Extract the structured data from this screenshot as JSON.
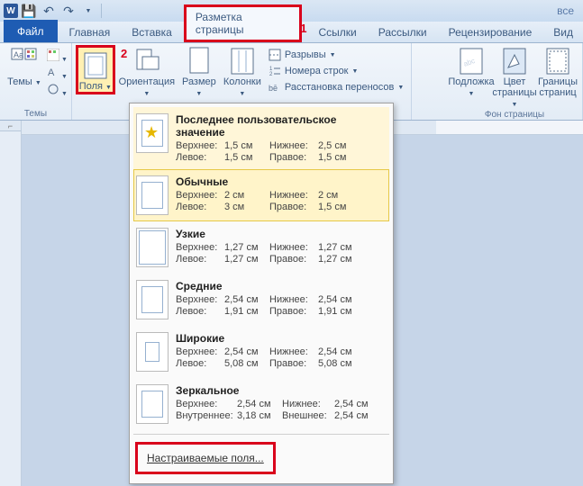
{
  "qat": {
    "save": "💾",
    "undo": "↶",
    "redo": "↷"
  },
  "titlebar_right": "все",
  "tabs": {
    "file": "Файл",
    "home": "Главная",
    "insert": "Вставка",
    "layout": "Разметка страницы",
    "references": "Ссылки",
    "mailings": "Рассылки",
    "review": "Рецензирование",
    "view": "Вид"
  },
  "annotation1": "1",
  "annotation2": "2",
  "ribbon": {
    "themes_group": "Темы",
    "themes": "Темы",
    "margins": "Поля",
    "orientation": "Ориентация",
    "size": "Размер",
    "columns": "Колонки",
    "breaks": "Разрывы",
    "line_numbers": "Номера строк",
    "hyphenation": "Расстановка переносов",
    "watermark": "Подложка",
    "page_color": "Цвет страницы",
    "borders": "Границы страниц",
    "bg_group": "Фон страницы"
  },
  "dropdown": {
    "last": {
      "title": "Последнее пользовательское значение",
      "top_l": "Верхнее:",
      "top_v": "1,5 см",
      "bot_l": "Нижнее:",
      "bot_v": "2,5 см",
      "left_l": "Левое:",
      "left_v": "1,5 см",
      "right_l": "Правое:",
      "right_v": "1,5 см"
    },
    "normal": {
      "title": "Обычные",
      "top_l": "Верхнее:",
      "top_v": "2 см",
      "bot_l": "Нижнее:",
      "bot_v": "2 см",
      "left_l": "Левое:",
      "left_v": "3 см",
      "right_l": "Правое:",
      "right_v": "1,5 см"
    },
    "narrow": {
      "title": "Узкие",
      "top_l": "Верхнее:",
      "top_v": "1,27 см",
      "bot_l": "Нижнее:",
      "bot_v": "1,27 см",
      "left_l": "Левое:",
      "left_v": "1,27 см",
      "right_l": "Правое:",
      "right_v": "1,27 см"
    },
    "moderate": {
      "title": "Средние",
      "top_l": "Верхнее:",
      "top_v": "2,54 см",
      "bot_l": "Нижнее:",
      "bot_v": "2,54 см",
      "left_l": "Левое:",
      "left_v": "1,91 см",
      "right_l": "Правое:",
      "right_v": "1,91 см"
    },
    "wide": {
      "title": "Широкие",
      "top_l": "Верхнее:",
      "top_v": "2,54 см",
      "bot_l": "Нижнее:",
      "bot_v": "2,54 см",
      "left_l": "Левое:",
      "left_v": "5,08 см",
      "right_l": "Правое:",
      "right_v": "5,08 см"
    },
    "mirrored": {
      "title": "Зеркальное",
      "top_l": "Верхнее:",
      "top_v": "2,54 см",
      "bot_l": "Нижнее:",
      "bot_v": "2,54 см",
      "in_l": "Внутреннее:",
      "in_v": "3,18 см",
      "out_l": "Внешнее:",
      "out_v": "2,54 см"
    },
    "custom": "Настраиваемые поля..."
  },
  "tab_selector": "⌐"
}
